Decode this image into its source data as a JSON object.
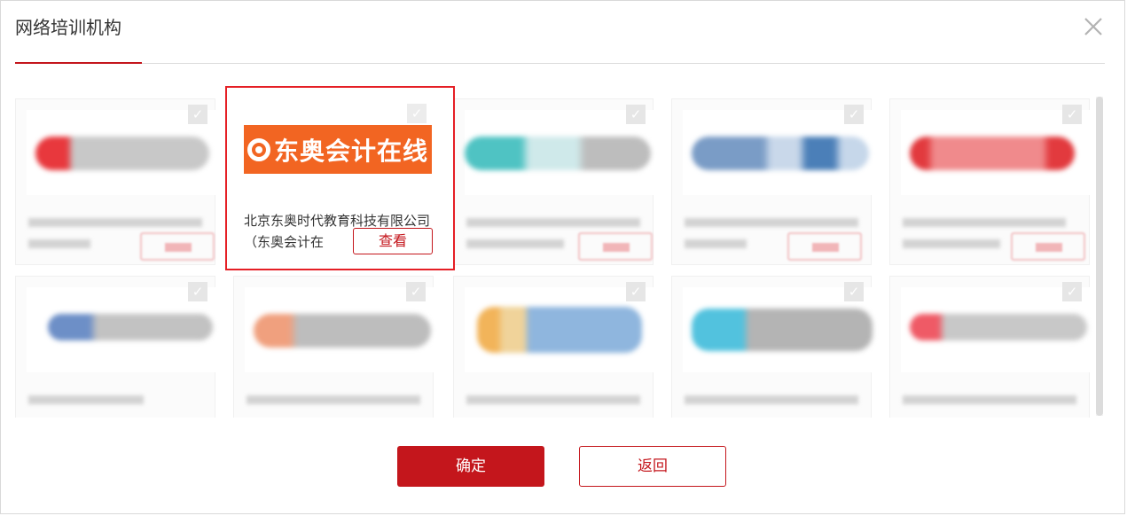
{
  "dialog": {
    "title": "网络培训机构",
    "close_icon": "close-icon"
  },
  "selected_card": {
    "logo_text": "东奥会计在线",
    "org_name": "北京东奥时代教育科技有限公司（东奥会计在",
    "view_label": "查看"
  },
  "footer": {
    "confirm_label": "确定",
    "back_label": "返回"
  },
  "colors": {
    "accent": "#c4161c",
    "selection_border": "#e51f25",
    "logo_orange": "#f26522"
  }
}
